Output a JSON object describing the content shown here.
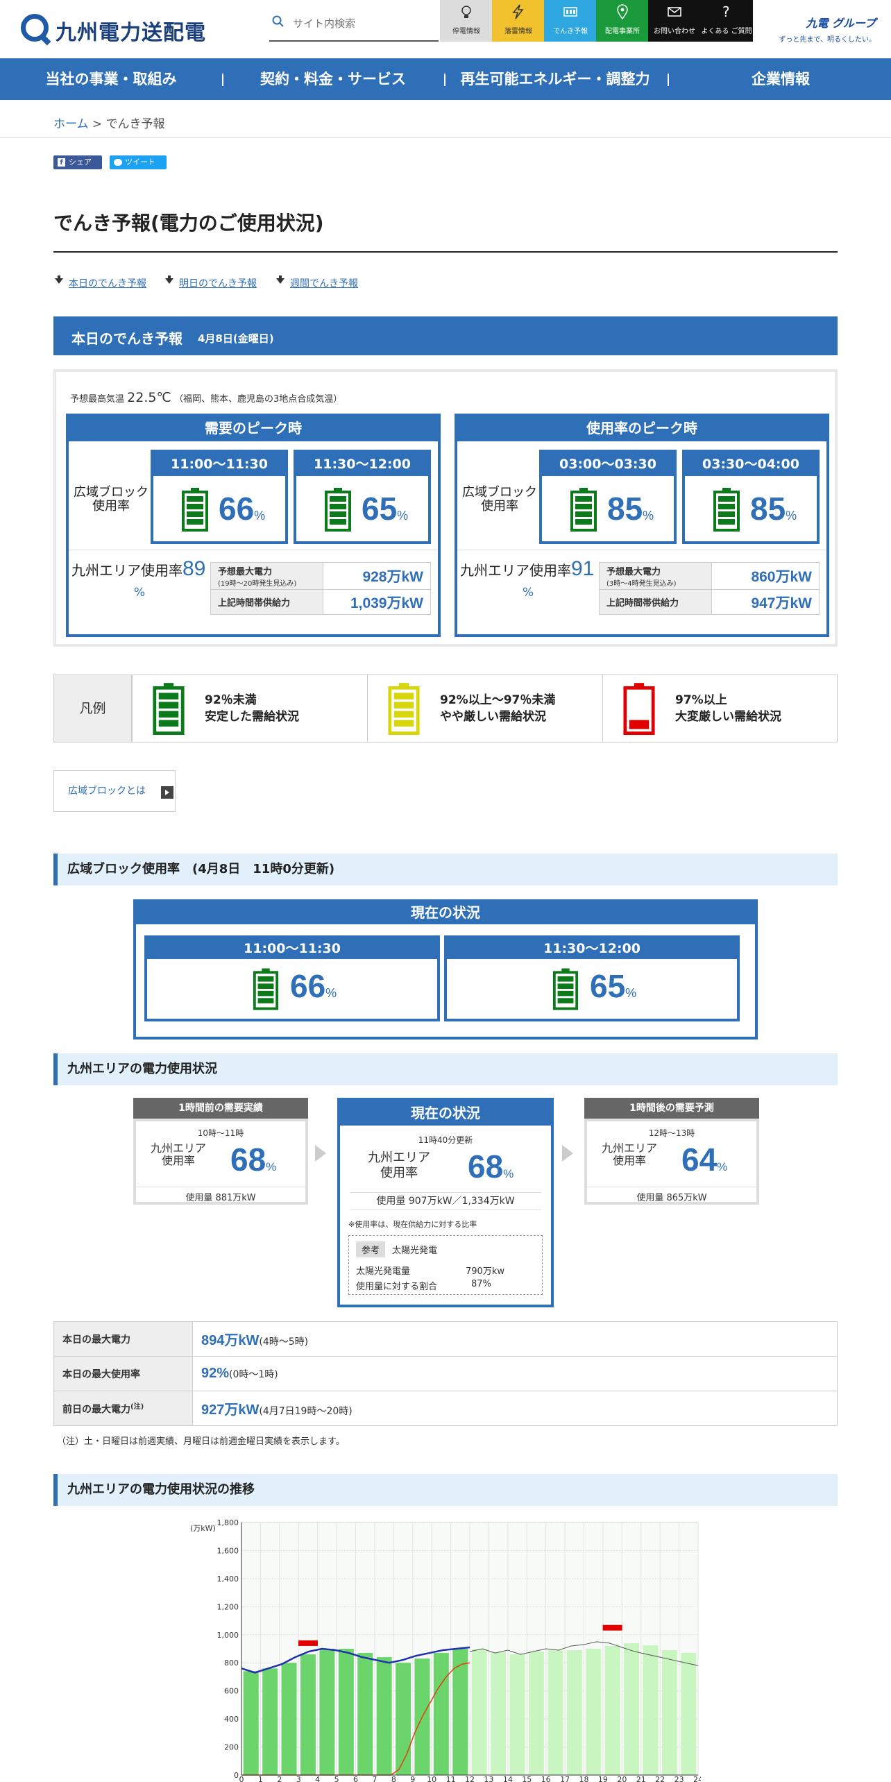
{
  "header": {
    "logo": "九州電力送配電",
    "search_placeholder": "サイト内検索",
    "quick": [
      {
        "label": "停電情報",
        "icon": "bulb-icon",
        "bg": "#dcdcdc"
      },
      {
        "label": "落雷情報",
        "icon": "lightning-icon",
        "bg": "#f2c12e"
      },
      {
        "label": "でんき予報",
        "icon": "battery-icon",
        "bg": "#2ea7e0"
      },
      {
        "label": "配電事業所",
        "icon": "map-pin-icon",
        "bg": "#1a9a3a"
      },
      {
        "label": "お問い合わせ",
        "icon": "mail-icon",
        "bg": "#111111"
      },
      {
        "label": "よくある ご質問",
        "icon": "question-icon",
        "bg": "#111111"
      }
    ],
    "brand_name": "九電 グループ",
    "brand_tag": "ずっと先まで、明るくしたい。"
  },
  "nav": [
    "当社の事業・取組み",
    "契約・料金・サービス",
    "再生可能エネルギー・調整力",
    "企業情報"
  ],
  "breadcrumb": {
    "home": "ホーム",
    "sep": " > ",
    "current": "でんき予報"
  },
  "social": {
    "share": "シェア",
    "tweet": "ツイート"
  },
  "page_title": "でんき予報(電力のご使用状況)",
  "anchors": [
    "本日のでんき予報",
    "明日のでんき予報",
    "週間でんき予報"
  ],
  "today": {
    "title": "本日のでんき予報",
    "date": "4月8日(金曜日)",
    "temp_label": "予想最高気温",
    "temp": "22.5℃",
    "temp_note": "（福岡、熊本、鹿児島の3地点合成気温）",
    "block_label": "広域ブロック使用率",
    "area_label": "九州エリア使用率",
    "pct_unit": "%",
    "demand": {
      "title": "需要のピーク時",
      "slots": [
        {
          "time": "11:00～11:30",
          "pct": "66"
        },
        {
          "time": "11:30～12:00",
          "pct": "65"
        }
      ],
      "area_pct": "89",
      "rows": [
        {
          "k": "予想最大電力",
          "sub": "(19時〜20時発生見込み)",
          "v": "928万kW"
        },
        {
          "k": "上記時間帯供給力",
          "sub": "",
          "v": "1,039万kW"
        }
      ]
    },
    "usage": {
      "title": "使用率のピーク時",
      "slots": [
        {
          "time": "03:00～03:30",
          "pct": "85"
        },
        {
          "time": "03:30～04:00",
          "pct": "85"
        }
      ],
      "area_pct": "91",
      "rows": [
        {
          "k": "予想最大電力",
          "sub": "(3時〜4時発生見込み)",
          "v": "860万kW"
        },
        {
          "k": "上記時間帯供給力",
          "sub": "",
          "v": "947万kW"
        }
      ]
    }
  },
  "legend": {
    "title": "凡例",
    "items": [
      {
        "l1": "92％未満",
        "l2": "安定した需給状況",
        "color": "#0a7a1a"
      },
      {
        "l1": "92%以上～97％未満",
        "l2": "やや厳しい需給状況",
        "color": "#d6d60a"
      },
      {
        "l1": "97%以上",
        "l2": "大変厳しい需給状況",
        "color": "#e00000"
      }
    ]
  },
  "about": "広域ブロックとは",
  "block_section": {
    "title": "広域ブロック使用率　(4月8日　11時0分更新)",
    "current_title": "現在の状況",
    "slots": [
      {
        "time": "11:00～11:30",
        "pct": "66"
      },
      {
        "time": "11:30～12:00",
        "pct": "65"
      }
    ]
  },
  "area_section": {
    "title": "九州エリアの電力使用状況",
    "prev": {
      "title": "1時間前の需要実績",
      "time": "10時～11時",
      "label": "九州エリア 使用率",
      "pct": "68",
      "usage": "使用量 881万kW"
    },
    "now": {
      "title": "現在の状況",
      "time": "11時40分更新",
      "label": "九州エリア 使用率",
      "pct": "68",
      "usage": "使用量 907万kW／1,334万kW",
      "note": "※使用率は、現在供給力に対する比率",
      "ref_tag": "参考",
      "ref_title": "太陽光発電",
      "ref_rows": [
        {
          "k": "太陽光発電量",
          "v": "790万kw"
        },
        {
          "k": "使用量に対する割合",
          "v": "87%"
        }
      ]
    },
    "next": {
      "title": "1時間後の需要予測",
      "time": "12時～13時",
      "label": "九州エリア 使用率",
      "pct": "64",
      "usage": "使用量 865万kW"
    }
  },
  "max_table": [
    {
      "k": "本日の最大電力",
      "sup": "",
      "v": "894万kW",
      "n": "(4時～5時)"
    },
    {
      "k": "本日の最大使用率",
      "sup": "",
      "v": "92%",
      "n": "(0時～1時)"
    },
    {
      "k": "前日の最大電力",
      "sup": "(注)",
      "v": "927万kW",
      "n": "(4月7日19時～20時)"
    }
  ],
  "footnote": "（注）土・日曜日は前週実績、月曜日は前週金曜日実績を表示します。",
  "trend_title": "九州エリアの電力使用状況の推移",
  "chart_data": {
    "type": "bar",
    "ylabel": "(万kW)",
    "ylim": [
      0,
      1800
    ],
    "yticks": [
      "0",
      "200",
      "400",
      "600",
      "800",
      "1,000",
      "1,200",
      "1,400",
      "1,600",
      "1,800"
    ],
    "x": [
      "0",
      "1",
      "2",
      "3",
      "4",
      "5",
      "6",
      "7",
      "8",
      "9",
      "10",
      "11",
      "12",
      "13",
      "14",
      "15",
      "16",
      "17",
      "18",
      "19",
      "20",
      "21",
      "22",
      "23",
      "24"
    ],
    "actual_bars": [
      740,
      760,
      800,
      860,
      900,
      900,
      870,
      840,
      800,
      830,
      870,
      900
    ],
    "forecast_bars": [
      895,
      875,
      860,
      880,
      890,
      890,
      900,
      920,
      940,
      925,
      890,
      870
    ],
    "actual_line": [
      760,
      730,
      760,
      790,
      840,
      880,
      900,
      890,
      870,
      840,
      820,
      800,
      820,
      850,
      870,
      890,
      900,
      910
    ],
    "forecast_line": [
      880,
      900,
      870,
      890,
      860,
      880,
      900,
      890,
      920,
      930,
      950,
      940,
      910,
      880,
      860,
      840,
      820,
      800,
      780
    ],
    "solar_line": [
      0,
      0,
      0,
      0,
      0,
      0,
      0,
      0,
      0,
      0,
      0,
      0,
      0,
      0,
      0,
      0,
      0,
      0,
      0,
      0,
      40,
      150,
      300,
      420,
      520,
      620,
      700,
      760,
      790,
      800
    ],
    "peak_markers": [
      {
        "x": 3.5,
        "y": 940
      },
      {
        "x": 19.5,
        "y": 1050
      }
    ],
    "colors": {
      "actual": "#6bd46b",
      "forecast": "#c8f5c0",
      "line": "#2030b0",
      "solar": "#e04010",
      "marker": "#e00000"
    }
  }
}
